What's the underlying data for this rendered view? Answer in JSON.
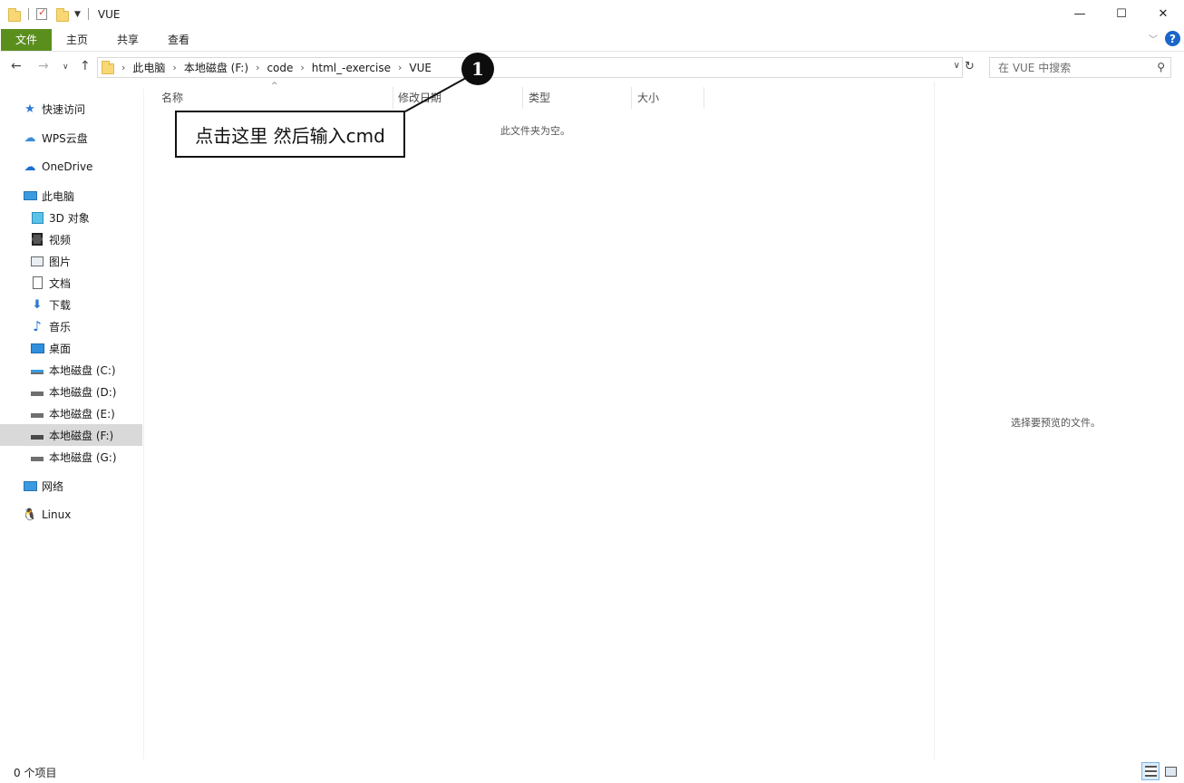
{
  "window": {
    "title": "VUE",
    "minimize": "—",
    "maximize": "☐",
    "close": "✕"
  },
  "ribbon": {
    "tabs": [
      "文件",
      "主页",
      "共享",
      "查看"
    ],
    "help": "?"
  },
  "address": {
    "crumbs": [
      "此电脑",
      "本地磁盘 (F:)",
      "code",
      "html_-exercise",
      "VUE"
    ],
    "search_placeholder": "在 VUE 中搜索"
  },
  "sidebar": {
    "items": [
      {
        "label": "快速访问",
        "icon": "star-icon"
      },
      {
        "label": "WPS云盘",
        "icon": "cloud-icon"
      },
      {
        "label": "OneDrive",
        "icon": "onedrive-icon"
      },
      {
        "label": "此电脑",
        "icon": "computer-icon"
      },
      {
        "label": "3D 对象",
        "icon": "cube-icon"
      },
      {
        "label": "视频",
        "icon": "video-icon"
      },
      {
        "label": "图片",
        "icon": "picture-icon"
      },
      {
        "label": "文档",
        "icon": "document-icon"
      },
      {
        "label": "下载",
        "icon": "download-icon"
      },
      {
        "label": "音乐",
        "icon": "music-icon"
      },
      {
        "label": "桌面",
        "icon": "desktop-icon"
      },
      {
        "label": "本地磁盘 (C:)",
        "icon": "drive-icon"
      },
      {
        "label": "本地磁盘 (D:)",
        "icon": "drive-icon"
      },
      {
        "label": "本地磁盘 (E:)",
        "icon": "drive-icon"
      },
      {
        "label": "本地磁盘 (F:)",
        "icon": "drive-icon",
        "selected": true
      },
      {
        "label": "本地磁盘 (G:)",
        "icon": "drive-icon"
      },
      {
        "label": "网络",
        "icon": "network-icon"
      },
      {
        "label": "Linux",
        "icon": "linux-icon"
      }
    ]
  },
  "content": {
    "columns": [
      "名称",
      "修改日期",
      "类型",
      "大小"
    ],
    "empty_message": "此文件夹为空。"
  },
  "preview": {
    "message": "选择要预览的文件。"
  },
  "status": {
    "count": "0 个项目"
  },
  "annotation": {
    "marker": "1",
    "text": "点击这里 然后输入cmd"
  },
  "colors": {
    "file_tab": "#5a8f1e",
    "help": "#1b66c9",
    "selected": "#d9d9d9"
  }
}
